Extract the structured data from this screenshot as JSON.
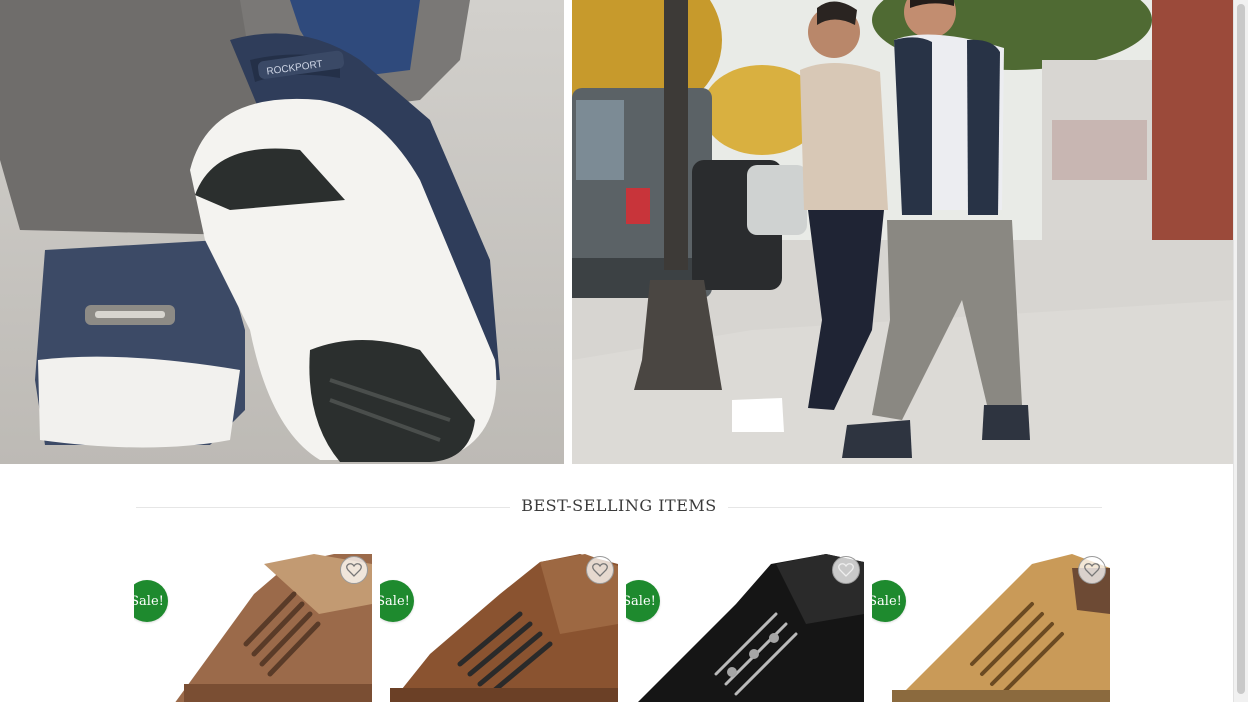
{
  "section": {
    "title": "BEST-SELLING ITEMS"
  },
  "hero": {
    "left_image": "closeup-shoe-sole-image",
    "right_image": "two-men-walking-street-image",
    "left_brand": "ROCKPORT"
  },
  "products": [
    {
      "badge": "Sale!",
      "icon": "heart-icon",
      "color": "#9b6a4a"
    },
    {
      "badge": "Sale!",
      "icon": "heart-icon",
      "color": "#8a5330"
    },
    {
      "badge": "Sale!",
      "icon": "heart-icon",
      "color": "#151515"
    },
    {
      "badge": "Sale!",
      "icon": "heart-icon",
      "color": "#c99a58"
    }
  ],
  "colors": {
    "sale": "#1e8a2e",
    "title": "#3a3a3a"
  }
}
